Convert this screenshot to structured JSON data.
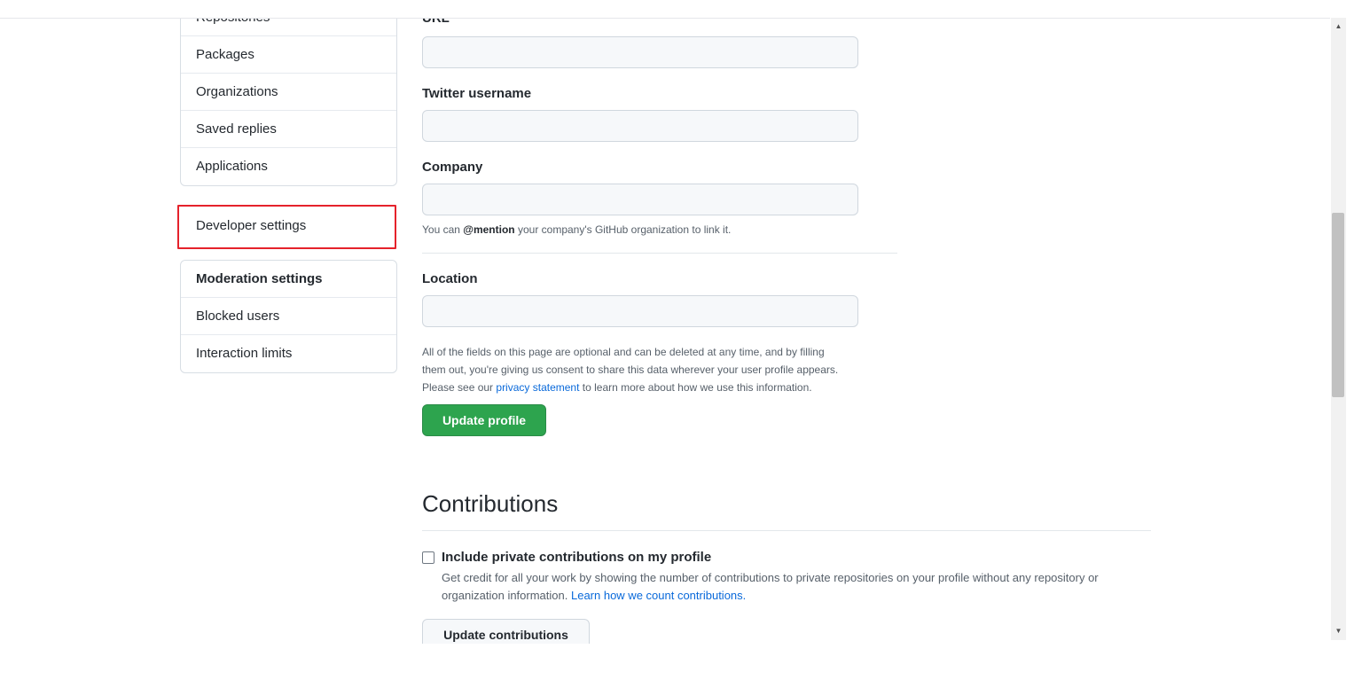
{
  "sidebar": {
    "group1": [
      "Repositories",
      "Packages",
      "Organizations",
      "Saved replies",
      "Applications"
    ],
    "developer_settings": "Developer settings",
    "moderation": {
      "heading": "Moderation settings",
      "items": [
        "Blocked users",
        "Interaction limits"
      ]
    }
  },
  "form": {
    "url_label": "URL",
    "twitter_label": "Twitter username",
    "company_label": "Company",
    "company_note": {
      "before": "You can ",
      "mention": "@mention",
      "after": " your company's GitHub organization to link it."
    },
    "location_label": "Location",
    "privacy_note": {
      "line1": "All of the fields on this page are optional and can be deleted at any time, and by filling",
      "line2": "them out, you're giving us consent to share this data wherever your user profile appears.",
      "line3_before": "Please see our ",
      "line3_link": "privacy statement",
      "line3_after": " to learn more about how we use this information."
    },
    "update_button": "Update profile"
  },
  "contributions": {
    "title": "Contributions",
    "checkbox_label": "Include private contributions on my profile",
    "help_text": "Get credit for all your work by showing the number of contributions to private repositories on your profile without any repository or organization information. ",
    "help_link": "Learn how we count contributions.",
    "update_button": "Update contributions",
    "checked": false
  },
  "scrollbar": {
    "up_icon": "triangle-up-icon",
    "down_icon": "triangle-down-icon"
  },
  "colors": {
    "primary_button": "#2da44e",
    "highlight_border": "#e5222b",
    "link": "#0969da"
  }
}
